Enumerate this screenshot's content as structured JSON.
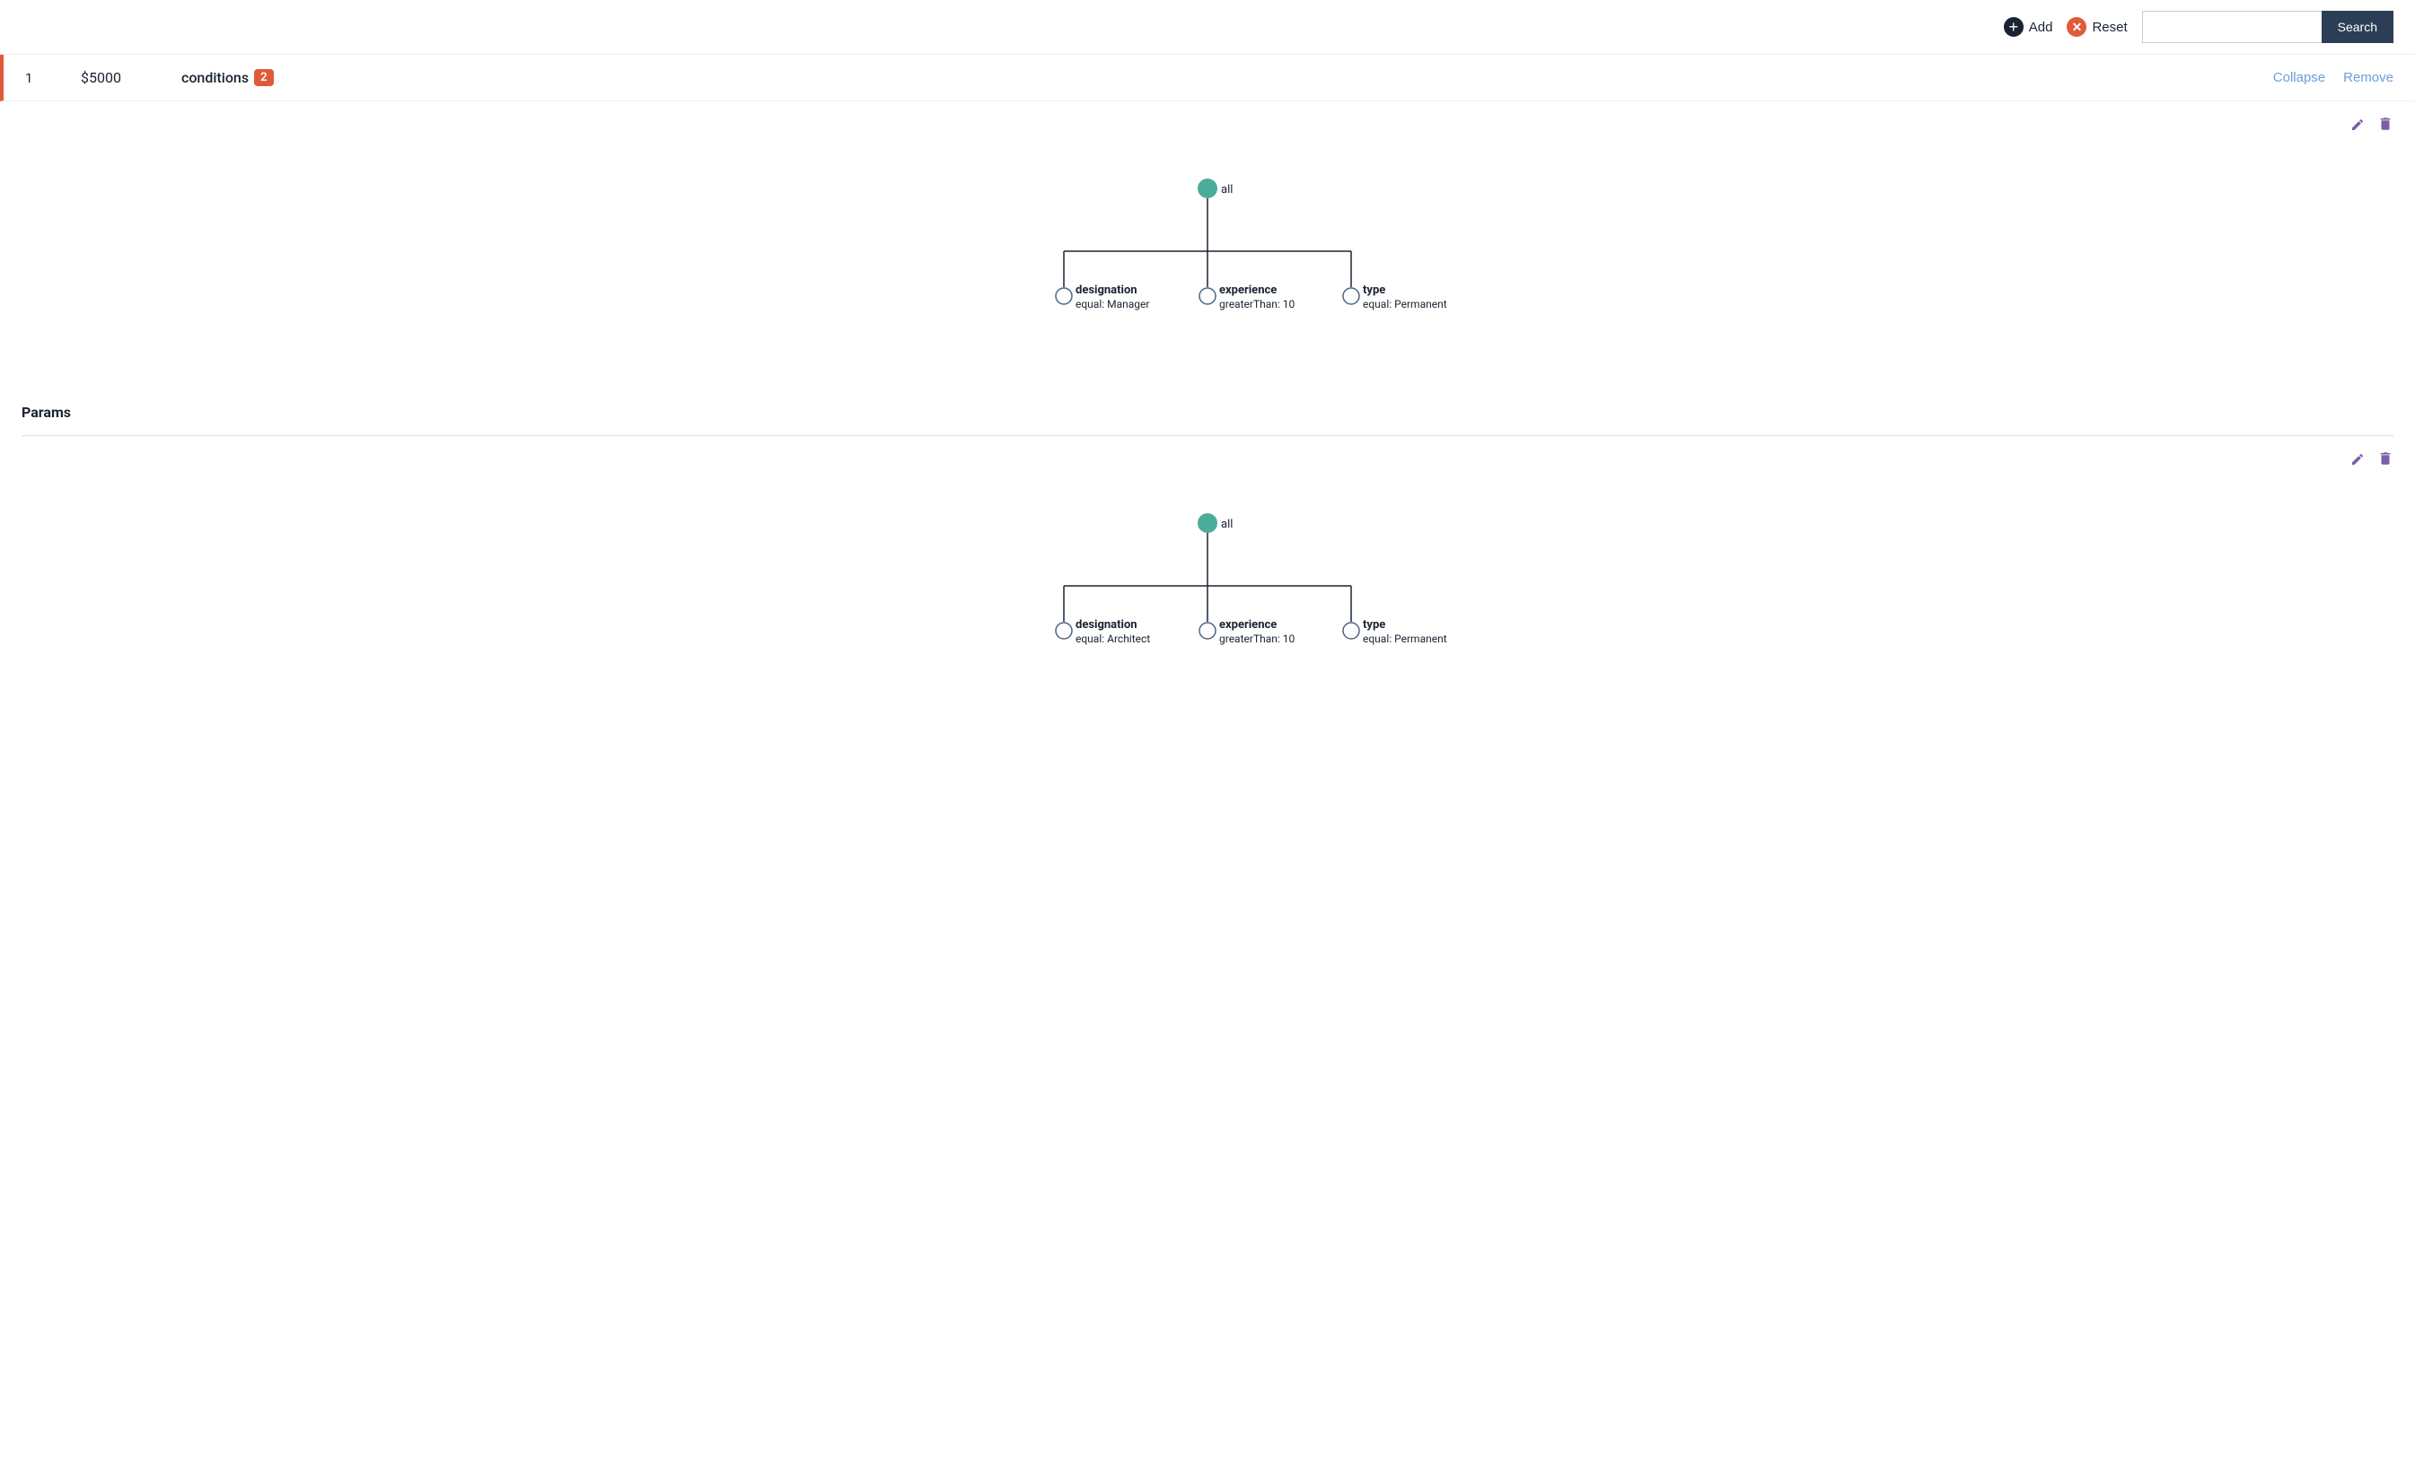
{
  "toolbar": {
    "add_label": "Add",
    "reset_label": "Reset",
    "search_label": "Search",
    "search_placeholder": ""
  },
  "rule": {
    "number": "1",
    "amount": "$5000",
    "conditions_label": "conditions",
    "conditions_count": "2",
    "collapse_label": "Collapse",
    "remove_label": "Remove"
  },
  "tree1": {
    "root_label": "all",
    "nodes": [
      {
        "field": "designation",
        "operator": "equal:",
        "value": "Manager"
      },
      {
        "field": "experience",
        "operator": "greaterThan:",
        "value": "10"
      },
      {
        "field": "type",
        "operator": "equal:",
        "value": "Permanent"
      }
    ]
  },
  "params_label": "Params",
  "tree2": {
    "root_label": "all",
    "nodes": [
      {
        "field": "designation",
        "operator": "equal:",
        "value": "Architect"
      },
      {
        "field": "experience",
        "operator": "greaterThan:",
        "value": "10"
      },
      {
        "field": "type",
        "operator": "equal:",
        "value": "Permanent"
      }
    ]
  },
  "icons": {
    "add": "+",
    "reset": "✕",
    "edit": "✎",
    "delete": "🗑"
  }
}
